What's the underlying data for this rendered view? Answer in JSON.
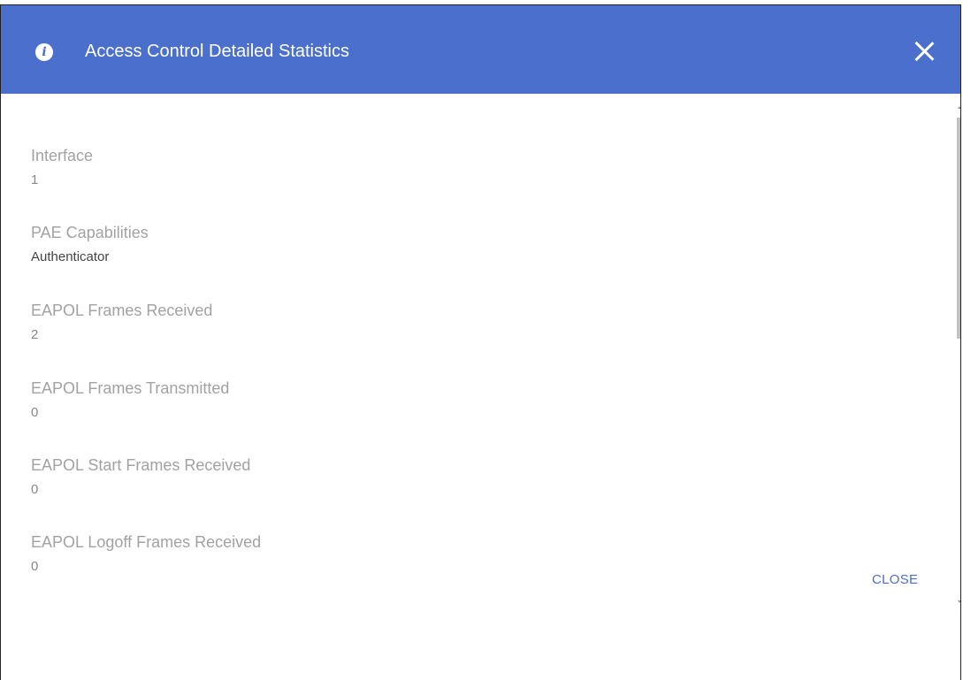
{
  "dialog": {
    "title": "Access Control Detailed Statistics",
    "header_color": "#4a6fcc",
    "info_icon": "info-icon",
    "info_glyph": "i",
    "close_icon": "close-icon"
  },
  "fields": [
    {
      "label": "Interface",
      "value": "1"
    },
    {
      "label": "PAE Capabilities",
      "value": "Authenticator"
    },
    {
      "label": "EAPOL Frames Received",
      "value": "2"
    },
    {
      "label": "EAPOL Frames Transmitted",
      "value": "0"
    },
    {
      "label": "EAPOL Start Frames Received",
      "value": "0"
    },
    {
      "label": "EAPOL Logoff Frames Received",
      "value": "0"
    }
  ],
  "footer": {
    "close_label": "CLOSE"
  }
}
